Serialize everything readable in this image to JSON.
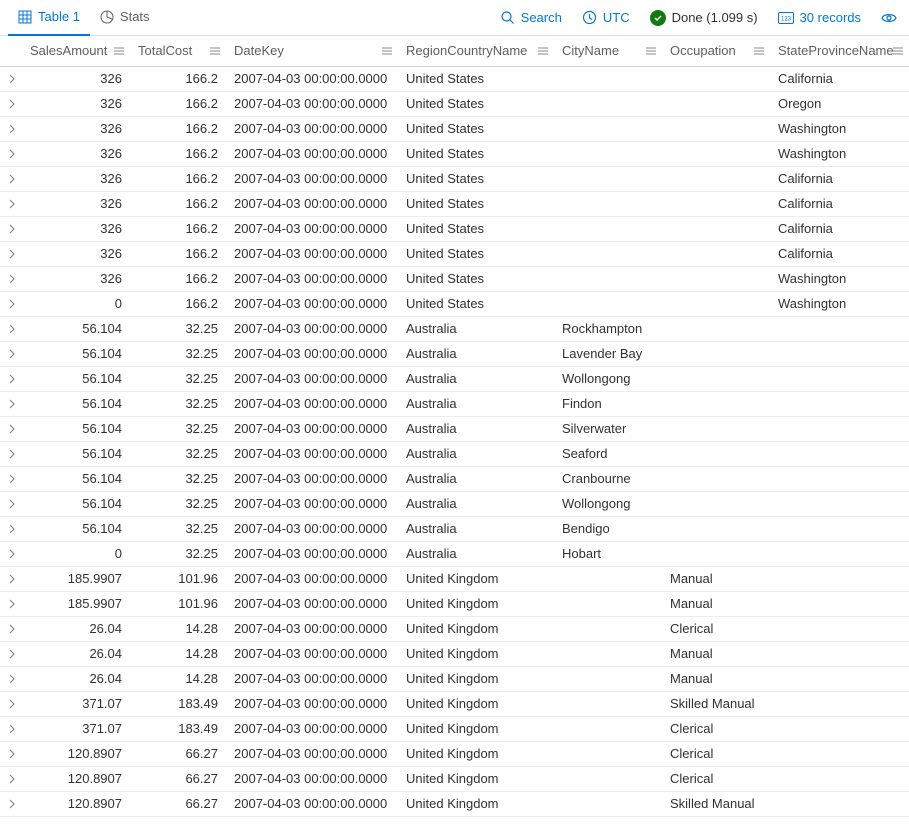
{
  "tabs": {
    "table": "Table 1",
    "stats": "Stats"
  },
  "toolbar": {
    "search": "Search",
    "utc": "UTC",
    "done": "Done (1.099 s)",
    "records": "30 records"
  },
  "columns": {
    "salesAmount": "SalesAmount",
    "totalCost": "TotalCost",
    "dateKey": "DateKey",
    "regionCountryName": "RegionCountryName",
    "cityName": "CityName",
    "occupation": "Occupation",
    "stateProvinceName": "StateProvinceName"
  },
  "rows": [
    {
      "salesAmount": "326",
      "totalCost": "166.2",
      "dateKey": "2007-04-03 00:00:00.0000",
      "region": "United States",
      "city": "",
      "occupation": "",
      "state": "California"
    },
    {
      "salesAmount": "326",
      "totalCost": "166.2",
      "dateKey": "2007-04-03 00:00:00.0000",
      "region": "United States",
      "city": "",
      "occupation": "",
      "state": "Oregon"
    },
    {
      "salesAmount": "326",
      "totalCost": "166.2",
      "dateKey": "2007-04-03 00:00:00.0000",
      "region": "United States",
      "city": "",
      "occupation": "",
      "state": "Washington"
    },
    {
      "salesAmount": "326",
      "totalCost": "166.2",
      "dateKey": "2007-04-03 00:00:00.0000",
      "region": "United States",
      "city": "",
      "occupation": "",
      "state": "Washington"
    },
    {
      "salesAmount": "326",
      "totalCost": "166.2",
      "dateKey": "2007-04-03 00:00:00.0000",
      "region": "United States",
      "city": "",
      "occupation": "",
      "state": "California"
    },
    {
      "salesAmount": "326",
      "totalCost": "166.2",
      "dateKey": "2007-04-03 00:00:00.0000",
      "region": "United States",
      "city": "",
      "occupation": "",
      "state": "California"
    },
    {
      "salesAmount": "326",
      "totalCost": "166.2",
      "dateKey": "2007-04-03 00:00:00.0000",
      "region": "United States",
      "city": "",
      "occupation": "",
      "state": "California"
    },
    {
      "salesAmount": "326",
      "totalCost": "166.2",
      "dateKey": "2007-04-03 00:00:00.0000",
      "region": "United States",
      "city": "",
      "occupation": "",
      "state": "California"
    },
    {
      "salesAmount": "326",
      "totalCost": "166.2",
      "dateKey": "2007-04-03 00:00:00.0000",
      "region": "United States",
      "city": "",
      "occupation": "",
      "state": "Washington"
    },
    {
      "salesAmount": "0",
      "totalCost": "166.2",
      "dateKey": "2007-04-03 00:00:00.0000",
      "region": "United States",
      "city": "",
      "occupation": "",
      "state": "Washington"
    },
    {
      "salesAmount": "56.104",
      "totalCost": "32.25",
      "dateKey": "2007-04-03 00:00:00.0000",
      "region": "Australia",
      "city": "Rockhampton",
      "occupation": "",
      "state": ""
    },
    {
      "salesAmount": "56.104",
      "totalCost": "32.25",
      "dateKey": "2007-04-03 00:00:00.0000",
      "region": "Australia",
      "city": "Lavender Bay",
      "occupation": "",
      "state": ""
    },
    {
      "salesAmount": "56.104",
      "totalCost": "32.25",
      "dateKey": "2007-04-03 00:00:00.0000",
      "region": "Australia",
      "city": "Wollongong",
      "occupation": "",
      "state": ""
    },
    {
      "salesAmount": "56.104",
      "totalCost": "32.25",
      "dateKey": "2007-04-03 00:00:00.0000",
      "region": "Australia",
      "city": "Findon",
      "occupation": "",
      "state": ""
    },
    {
      "salesAmount": "56.104",
      "totalCost": "32.25",
      "dateKey": "2007-04-03 00:00:00.0000",
      "region": "Australia",
      "city": "Silverwater",
      "occupation": "",
      "state": ""
    },
    {
      "salesAmount": "56.104",
      "totalCost": "32.25",
      "dateKey": "2007-04-03 00:00:00.0000",
      "region": "Australia",
      "city": "Seaford",
      "occupation": "",
      "state": ""
    },
    {
      "salesAmount": "56.104",
      "totalCost": "32.25",
      "dateKey": "2007-04-03 00:00:00.0000",
      "region": "Australia",
      "city": "Cranbourne",
      "occupation": "",
      "state": ""
    },
    {
      "salesAmount": "56.104",
      "totalCost": "32.25",
      "dateKey": "2007-04-03 00:00:00.0000",
      "region": "Australia",
      "city": "Wollongong",
      "occupation": "",
      "state": ""
    },
    {
      "salesAmount": "56.104",
      "totalCost": "32.25",
      "dateKey": "2007-04-03 00:00:00.0000",
      "region": "Australia",
      "city": "Bendigo",
      "occupation": "",
      "state": ""
    },
    {
      "salesAmount": "0",
      "totalCost": "32.25",
      "dateKey": "2007-04-03 00:00:00.0000",
      "region": "Australia",
      "city": "Hobart",
      "occupation": "",
      "state": ""
    },
    {
      "salesAmount": "185.9907",
      "totalCost": "101.96",
      "dateKey": "2007-04-03 00:00:00.0000",
      "region": "United Kingdom",
      "city": "",
      "occupation": "Manual",
      "state": ""
    },
    {
      "salesAmount": "185.9907",
      "totalCost": "101.96",
      "dateKey": "2007-04-03 00:00:00.0000",
      "region": "United Kingdom",
      "city": "",
      "occupation": "Manual",
      "state": ""
    },
    {
      "salesAmount": "26.04",
      "totalCost": "14.28",
      "dateKey": "2007-04-03 00:00:00.0000",
      "region": "United Kingdom",
      "city": "",
      "occupation": "Clerical",
      "state": ""
    },
    {
      "salesAmount": "26.04",
      "totalCost": "14.28",
      "dateKey": "2007-04-03 00:00:00.0000",
      "region": "United Kingdom",
      "city": "",
      "occupation": "Manual",
      "state": ""
    },
    {
      "salesAmount": "26.04",
      "totalCost": "14.28",
      "dateKey": "2007-04-03 00:00:00.0000",
      "region": "United Kingdom",
      "city": "",
      "occupation": "Manual",
      "state": ""
    },
    {
      "salesAmount": "371.07",
      "totalCost": "183.49",
      "dateKey": "2007-04-03 00:00:00.0000",
      "region": "United Kingdom",
      "city": "",
      "occupation": "Skilled Manual",
      "state": ""
    },
    {
      "salesAmount": "371.07",
      "totalCost": "183.49",
      "dateKey": "2007-04-03 00:00:00.0000",
      "region": "United Kingdom",
      "city": "",
      "occupation": "Clerical",
      "state": ""
    },
    {
      "salesAmount": "120.8907",
      "totalCost": "66.27",
      "dateKey": "2007-04-03 00:00:00.0000",
      "region": "United Kingdom",
      "city": "",
      "occupation": "Clerical",
      "state": ""
    },
    {
      "salesAmount": "120.8907",
      "totalCost": "66.27",
      "dateKey": "2007-04-03 00:00:00.0000",
      "region": "United Kingdom",
      "city": "",
      "occupation": "Clerical",
      "state": ""
    },
    {
      "salesAmount": "120.8907",
      "totalCost": "66.27",
      "dateKey": "2007-04-03 00:00:00.0000",
      "region": "United Kingdom",
      "city": "",
      "occupation": "Skilled Manual",
      "state": ""
    }
  ]
}
